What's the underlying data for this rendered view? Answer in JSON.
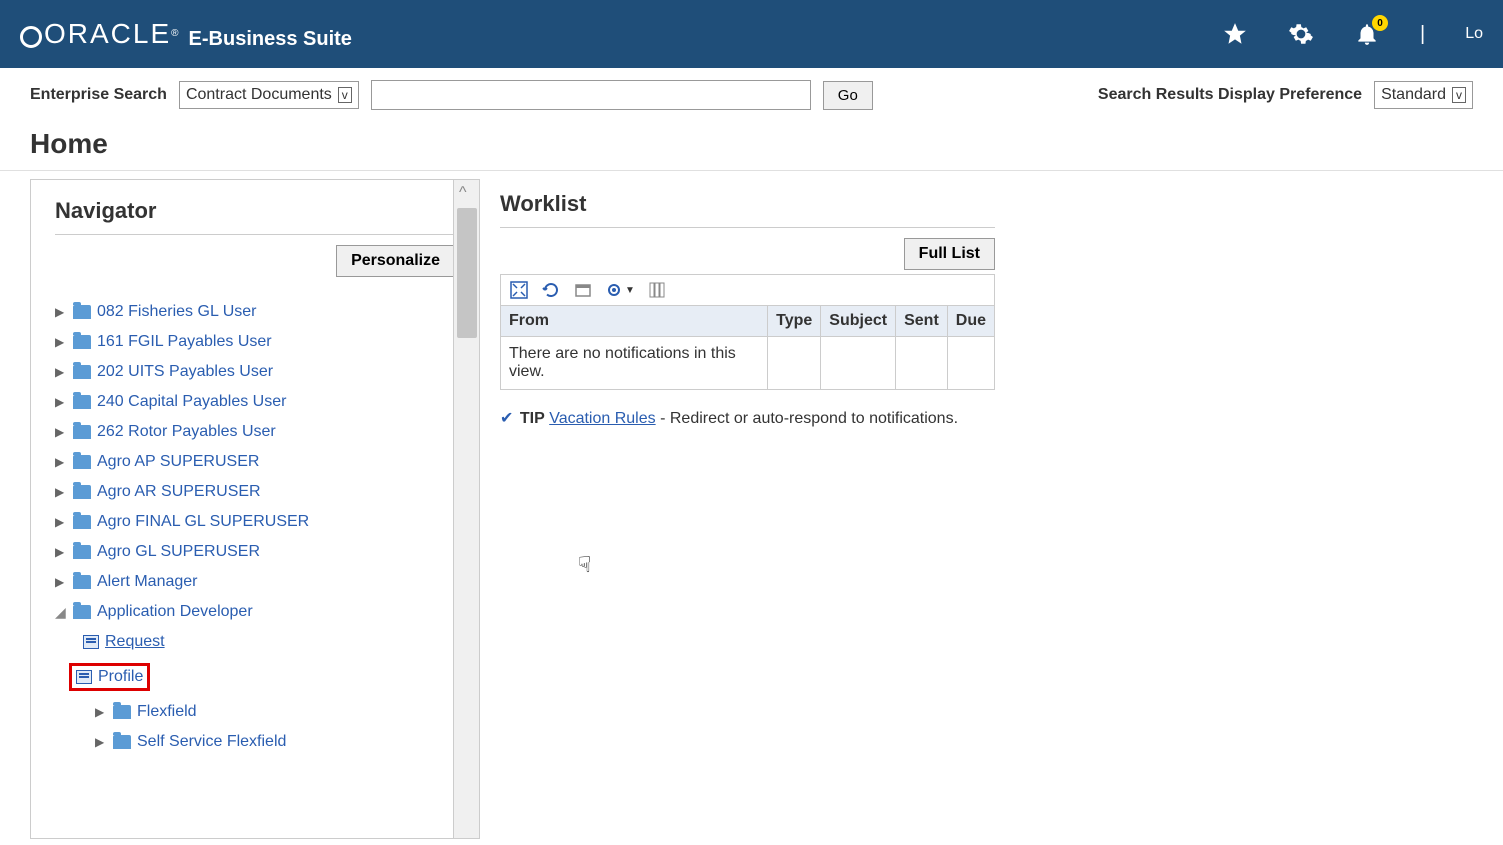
{
  "header": {
    "logo_text": "ORACLE",
    "suite_title": "E-Business Suite",
    "notif_count": "0",
    "logout_label": "Lo"
  },
  "search": {
    "label": "Enterprise Search",
    "scope_selected": "Contract Documents",
    "input_value": "",
    "go_label": "Go",
    "pref_label": "Search Results Display Preference",
    "pref_selected": "Standard"
  },
  "page_title": "Home",
  "navigator": {
    "title": "Navigator",
    "personalize_label": "Personalize",
    "items": [
      {
        "label": "082 Fisheries GL User",
        "expanded": false
      },
      {
        "label": "161 FGIL Payables User",
        "expanded": false
      },
      {
        "label": "202 UITS Payables User",
        "expanded": false
      },
      {
        "label": "240 Capital Payables User",
        "expanded": false
      },
      {
        "label": "262 Rotor Payables User",
        "expanded": false
      },
      {
        "label": "Agro AP SUPERUSER",
        "expanded": false
      },
      {
        "label": "Agro AR SUPERUSER",
        "expanded": false
      },
      {
        "label": "Agro FINAL GL SUPERUSER",
        "expanded": false
      },
      {
        "label": "Agro GL SUPERUSER",
        "expanded": false
      },
      {
        "label": "Alert Manager",
        "expanded": false
      },
      {
        "label": "Application Developer",
        "expanded": true
      }
    ],
    "app_dev_children": {
      "request": "Request",
      "profile": "Profile",
      "flexfield": "Flexfield",
      "self_service_flexfield": "Self Service Flexfield"
    }
  },
  "worklist": {
    "title": "Worklist",
    "full_list_label": "Full List",
    "columns": [
      "From",
      "Type",
      "Subject",
      "Sent",
      "Due"
    ],
    "empty_message": "There are no notifications in this view.",
    "tip_label": "TIP",
    "tip_link": "Vacation Rules",
    "tip_suffix": " - Redirect or auto-respond to notifications."
  }
}
